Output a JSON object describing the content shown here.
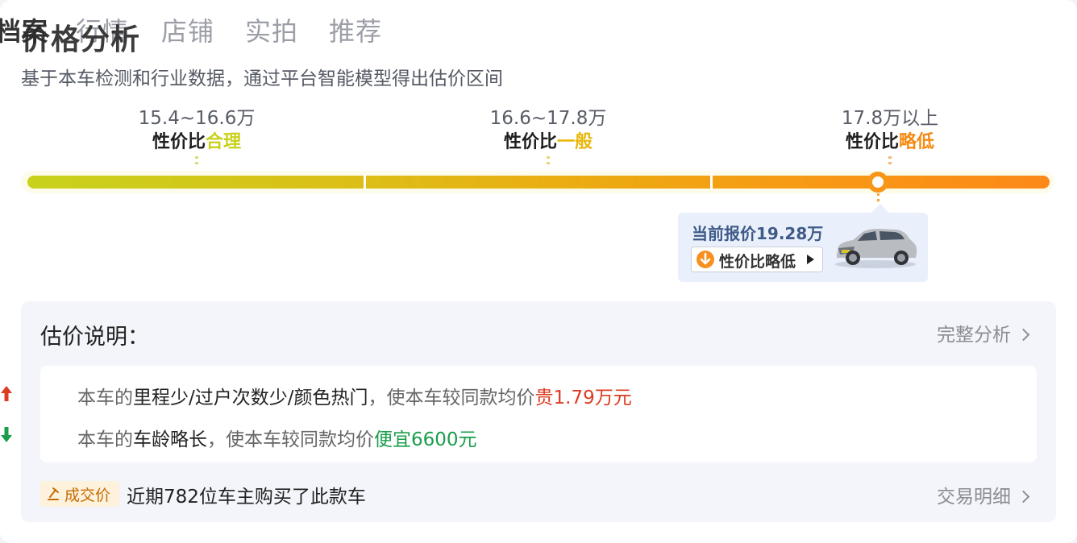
{
  "tabs": [
    "档案",
    "行情",
    "店铺",
    "实拍",
    "推荐"
  ],
  "section_title": "价格分析",
  "subtitle": "基于本车检测和行业数据，通过平台智能模型得出估价区间",
  "segments": [
    {
      "range": "15.4~16.6万",
      "tag_prefix": "性价比",
      "tag_word": "合理",
      "color": "#c9d11c"
    },
    {
      "range": "16.6~17.8万",
      "tag_prefix": "性价比",
      "tag_word": "一般",
      "color": "#e8b70d"
    },
    {
      "range": "17.8万以上",
      "tag_prefix": "性价比",
      "tag_word": "略低",
      "color": "#f58a12"
    }
  ],
  "current": {
    "price_text": "当前报价19.28万",
    "button_label": "性价比略低",
    "position_fraction": 0.83
  },
  "explain": {
    "title": "估价说明：",
    "link": "完整分析",
    "reasons": [
      {
        "prefix": "本车的",
        "highlight": "里程少/过户次数少/颜色热门",
        "middle": "，使本车较同款均价",
        "delta": "贵1.79万元",
        "direction": "up",
        "color": "#dd3b22"
      },
      {
        "prefix": "本车的",
        "highlight": "车龄略长",
        "middle": "，使本车较同款均价",
        "delta": "便宜6600元",
        "direction": "down",
        "color": "#1a9e4b"
      }
    ]
  },
  "deal": {
    "badge": "成交价",
    "text": "近期782位车主购买了此款车",
    "link": "交易明细"
  }
}
